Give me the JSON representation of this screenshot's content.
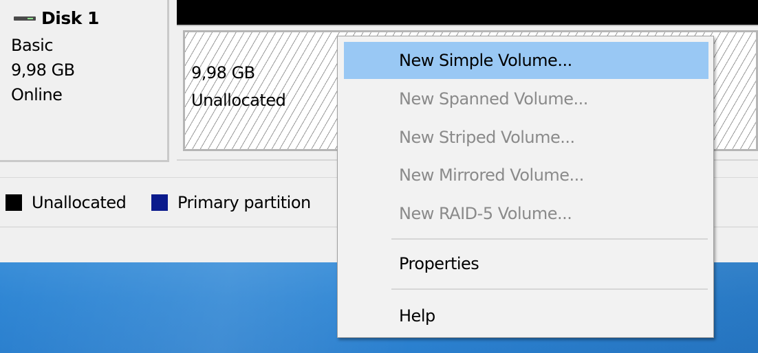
{
  "disk": {
    "name": "Disk 1",
    "type": "Basic",
    "size": "9,98 GB",
    "status": "Online"
  },
  "partition": {
    "size": "9,98 GB",
    "status": "Unallocated"
  },
  "legend": {
    "items": [
      {
        "label": "Unallocated",
        "color": "#000000"
      },
      {
        "label": "Primary partition",
        "color": "#0a1a8c"
      }
    ]
  },
  "context_menu": {
    "items": [
      {
        "label": "New Simple Volume...",
        "enabled": true,
        "highlighted": true
      },
      {
        "label": "New Spanned Volume...",
        "enabled": false
      },
      {
        "label": "New Striped Volume...",
        "enabled": false
      },
      {
        "label": "New Mirrored Volume...",
        "enabled": false
      },
      {
        "label": "New RAID-5 Volume...",
        "enabled": false
      },
      {
        "label": "Properties",
        "enabled": true
      },
      {
        "label": "Help",
        "enabled": true
      }
    ]
  },
  "colors": {
    "highlight": "#99c8f4",
    "disabled_text": "#8a8a8a",
    "desktop": "#2f86d4"
  },
  "icons": {
    "disk": "disk-drive-icon"
  }
}
